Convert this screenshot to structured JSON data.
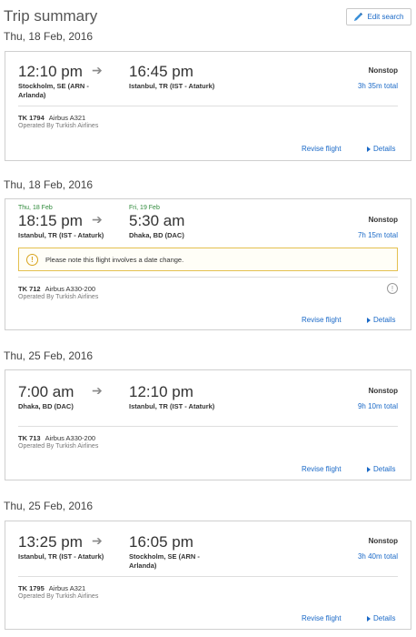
{
  "header": {
    "title": "Trip summary",
    "edit_label": "Edit search"
  },
  "segments": [
    {
      "date_heading": "Thu, 18 Feb, 2016",
      "dep_time": "12:10 pm",
      "arr_time": "16:45 pm",
      "dep_place": "Stockholm, SE (ARN - Arlanda)",
      "arr_place": "Istanbul, TR (IST - Ataturk)",
      "stops": "Nonstop",
      "duration": "3h 35m total",
      "flight_number": "TK 1794",
      "aircraft": "Airbus A321",
      "operated_by": "Operated By Turkish Airlines",
      "revise_label": "Revise flight",
      "details_label": "Details"
    },
    {
      "date_heading": "Thu, 18 Feb, 2016",
      "dep_date": "Thu, 18 Feb",
      "arr_date": "Fri, 19 Feb",
      "dep_time": "18:15 pm",
      "arr_time": "5:30 am",
      "dep_place": "Istanbul, TR (IST - Ataturk)",
      "arr_place": "Dhaka, BD (DAC)",
      "stops": "Nonstop",
      "duration": "7h 15m total",
      "notice": "Please note this flight involves a date change.",
      "flight_number": "TK 712",
      "aircraft": "Airbus A330-200",
      "operated_by": "Operated By Turkish Airlines",
      "revise_label": "Revise flight",
      "details_label": "Details"
    },
    {
      "date_heading": "Thu, 25 Feb, 2016",
      "dep_time": "7:00 am",
      "arr_time": "12:10 pm",
      "dep_place": "Dhaka, BD (DAC)",
      "arr_place": "Istanbul, TR (IST - Ataturk)",
      "stops": "Nonstop",
      "duration": "9h 10m total",
      "flight_number": "TK 713",
      "aircraft": "Airbus A330-200",
      "operated_by": "Operated By Turkish Airlines",
      "revise_label": "Revise flight",
      "details_label": "Details"
    },
    {
      "date_heading": "Thu, 25 Feb, 2016",
      "dep_time": "13:25 pm",
      "arr_time": "16:05 pm",
      "dep_place": "Istanbul, TR (IST - Ataturk)",
      "arr_place": "Stockholm, SE (ARN - Arlanda)",
      "stops": "Nonstop",
      "duration": "3h 40m total",
      "flight_number": "TK 1795",
      "aircraft": "Airbus A321",
      "operated_by": "Operated By Turkish Airlines",
      "revise_label": "Revise flight",
      "details_label": "Details"
    }
  ],
  "icons": {
    "edit": "pencil-icon",
    "arrow": "plane-arrow-icon",
    "warning": "warning-icon",
    "info": "info-icon",
    "details": "triangle-right-icon"
  },
  "colors": {
    "link": "#1a69c7",
    "date_change": "#2e8a3a",
    "notice_border": "#e4c04f"
  }
}
